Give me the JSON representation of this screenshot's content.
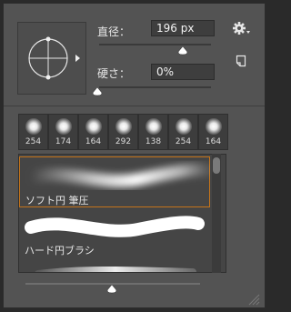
{
  "diameter": {
    "label": "直径：",
    "value": "196 px",
    "slider_fraction": 0.76
  },
  "hardness": {
    "label": "硬さ：",
    "value": "0%",
    "slider_fraction": 0.0
  },
  "icons": {
    "gear": "gear-icon",
    "new_preset": "new-preset-icon",
    "angle": "brush-angle-icon",
    "resize": "resize-grip-icon"
  },
  "thumbnails": [
    {
      "size": "254"
    },
    {
      "size": "174"
    },
    {
      "size": "164"
    },
    {
      "size": "292"
    },
    {
      "size": "138"
    },
    {
      "size": "254"
    },
    {
      "size": "164"
    }
  ],
  "brushes": [
    {
      "name": "ソフト円 筆圧",
      "selected": true
    },
    {
      "name": "ハード円ブラシ",
      "selected": false
    },
    {
      "name": "",
      "selected": false
    }
  ],
  "preview_slider": {
    "fraction": 0.5
  },
  "colors": {
    "panel": "#535353",
    "selection": "#c5741a",
    "field": "#3e3e3e"
  }
}
